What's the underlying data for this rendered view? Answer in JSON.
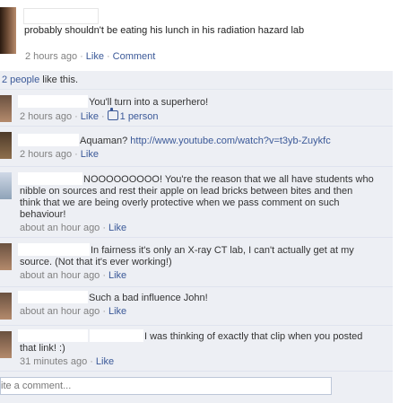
{
  "status": {
    "text": "probably shouldn't be eating his lunch in his radiation hazard lab",
    "time": "2 hours ago",
    "like": "Like",
    "comment": "Comment"
  },
  "likes": {
    "count_link": "2 people",
    "suffix": " like this."
  },
  "comments": [
    {
      "text": "You'll turn into a superhero!",
      "time": "2 hours ago",
      "like": "Like",
      "likes_count": "1 person"
    },
    {
      "text_prefix": "Aquaman? ",
      "link": "http://www.youtube.com/watch?v=t3yb-Zuykfc",
      "time": "2 hours ago",
      "like": "Like"
    },
    {
      "line1": "NOOOOOOOOO! You're the reason that we all have students who",
      "line2": "nibble on sources and rest their apple on lead bricks between bites and then",
      "line3": "think that we are being overly protective when we pass comment on such",
      "line4": "behaviour!",
      "time": "about an hour ago",
      "like": "Like"
    },
    {
      "line1": "In fairness it's only an X-ray CT lab, I can't actually get at my",
      "line2": "source. (Not that it's ever working!)",
      "time": "about an hour ago",
      "like": "Like"
    },
    {
      "text": "Such a bad influence John!",
      "time": "about an hour ago",
      "like": "Like"
    },
    {
      "line1": "I was thinking of exactly that clip when you posted",
      "line2": "that link! :)",
      "time": "31 minutes ago",
      "like": "Like"
    }
  ],
  "write_comment": {
    "placeholder": "ite a comment..."
  }
}
